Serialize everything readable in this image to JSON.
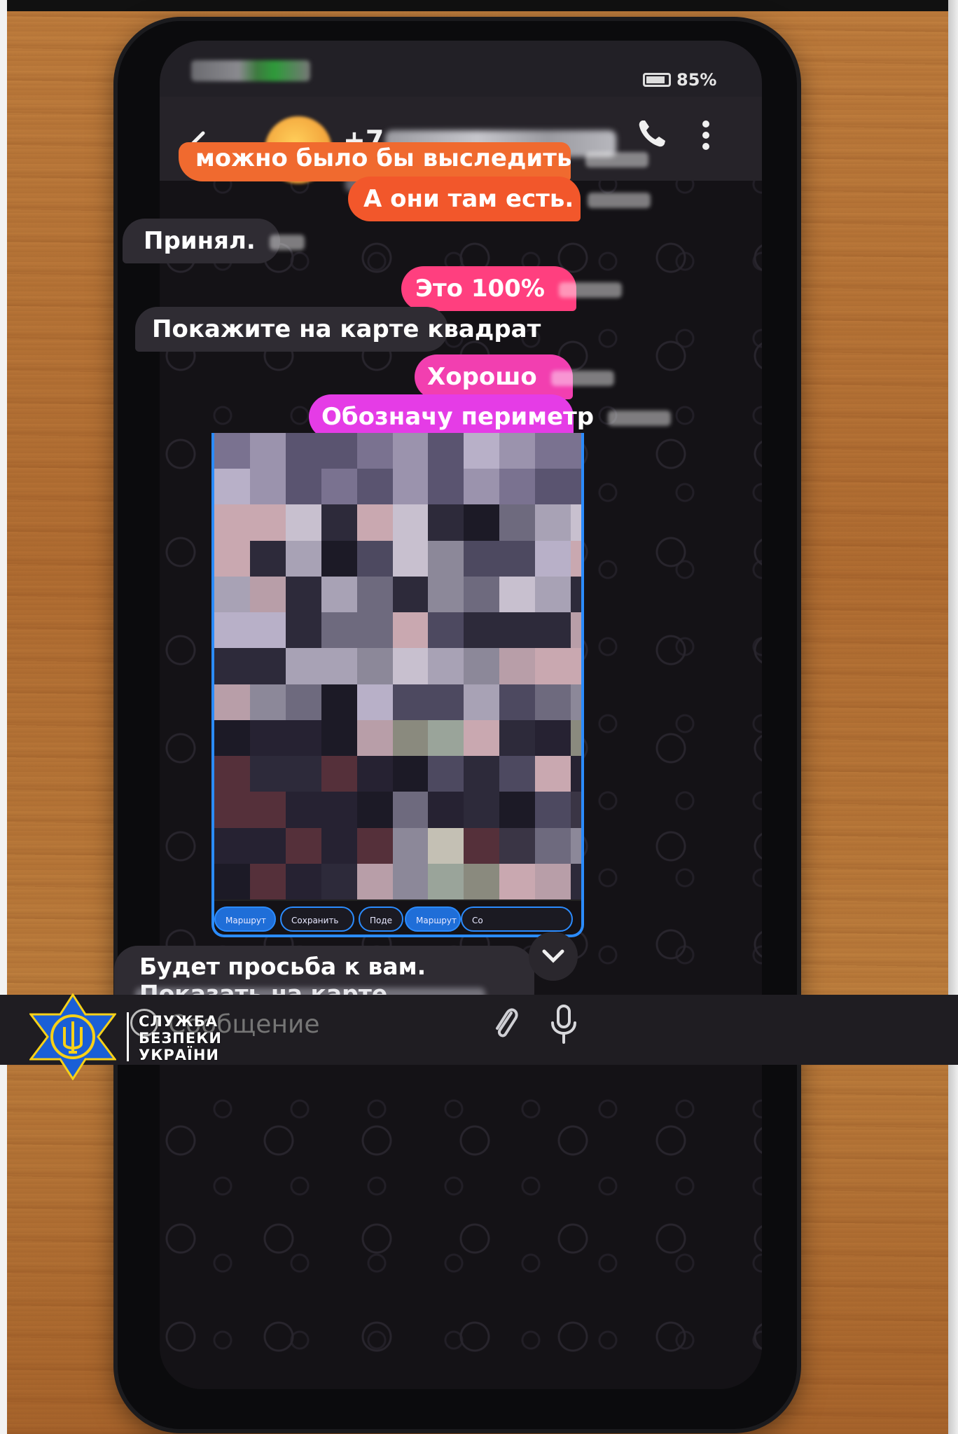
{
  "status_bar": {
    "battery": "85%"
  },
  "chat_header": {
    "contact_prefix": "+7"
  },
  "messages": [
    {
      "text": "можно было бы выследить",
      "direction": "outgoing"
    },
    {
      "text": "А они там есть.",
      "direction": "outgoing"
    },
    {
      "text": "Принял.",
      "direction": "incoming"
    },
    {
      "text": "Это 100%",
      "direction": "outgoing"
    },
    {
      "text": "Покажите на карте квадрат",
      "direction": "incoming"
    },
    {
      "text": "Хорошо",
      "direction": "outgoing"
    },
    {
      "text": "Обозначу периметр",
      "direction": "outgoing"
    }
  ],
  "image_card": {
    "actions": [
      "Маршрут",
      "Сохранить",
      "Поде",
      "Маршрут",
      "Со"
    ]
  },
  "last_message": {
    "text": "Будет просьба к вам. Показать на карте"
  },
  "composer": {
    "placeholder": "Сообщение"
  },
  "watermark": {
    "lines": [
      "СЛУЖБА",
      "БЕЗПЕКИ",
      "УКРАЇНИ"
    ]
  },
  "colors": {
    "bubble_orange": "#f06a2f",
    "bubble_pink": "#ff3f7f",
    "bubble_magenta": "#e53ce6",
    "accent_blue": "#2b8cff",
    "sbu_blue": "#1a5fd6",
    "sbu_gold": "#f7d117"
  },
  "icons": [
    "back-arrow-icon",
    "phone-icon",
    "more-vert-icon",
    "emoji-icon",
    "paperclip-icon",
    "microphone-icon",
    "chevron-down-icon",
    "battery-icon"
  ]
}
